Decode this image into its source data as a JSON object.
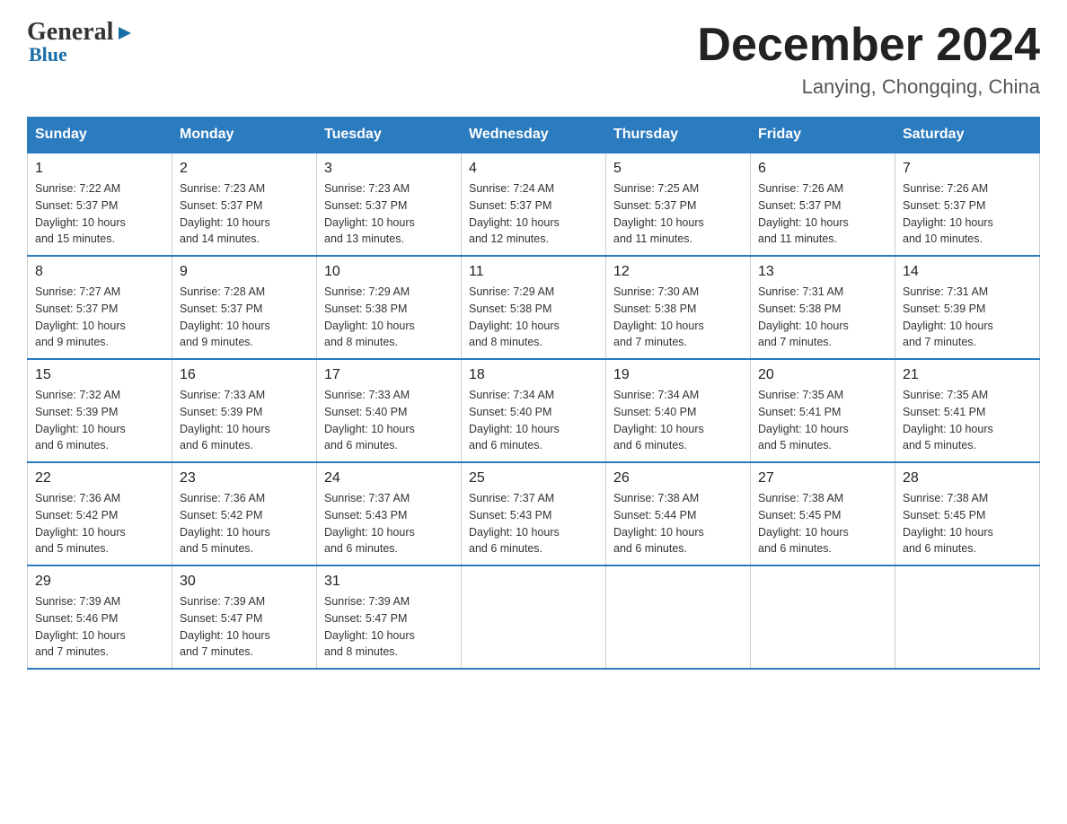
{
  "header": {
    "logo": {
      "general": "General",
      "blue": "Blue",
      "arrow": "▶"
    },
    "title": "December 2024",
    "location": "Lanying, Chongqing, China"
  },
  "days_of_week": [
    "Sunday",
    "Monday",
    "Tuesday",
    "Wednesday",
    "Thursday",
    "Friday",
    "Saturday"
  ],
  "weeks": [
    [
      {
        "day": "1",
        "sunrise": "7:22 AM",
        "sunset": "5:37 PM",
        "daylight": "10 hours and 15 minutes."
      },
      {
        "day": "2",
        "sunrise": "7:23 AM",
        "sunset": "5:37 PM",
        "daylight": "10 hours and 14 minutes."
      },
      {
        "day": "3",
        "sunrise": "7:23 AM",
        "sunset": "5:37 PM",
        "daylight": "10 hours and 13 minutes."
      },
      {
        "day": "4",
        "sunrise": "7:24 AM",
        "sunset": "5:37 PM",
        "daylight": "10 hours and 12 minutes."
      },
      {
        "day": "5",
        "sunrise": "7:25 AM",
        "sunset": "5:37 PM",
        "daylight": "10 hours and 11 minutes."
      },
      {
        "day": "6",
        "sunrise": "7:26 AM",
        "sunset": "5:37 PM",
        "daylight": "10 hours and 11 minutes."
      },
      {
        "day": "7",
        "sunrise": "7:26 AM",
        "sunset": "5:37 PM",
        "daylight": "10 hours and 10 minutes."
      }
    ],
    [
      {
        "day": "8",
        "sunrise": "7:27 AM",
        "sunset": "5:37 PM",
        "daylight": "10 hours and 9 minutes."
      },
      {
        "day": "9",
        "sunrise": "7:28 AM",
        "sunset": "5:37 PM",
        "daylight": "10 hours and 9 minutes."
      },
      {
        "day": "10",
        "sunrise": "7:29 AM",
        "sunset": "5:38 PM",
        "daylight": "10 hours and 8 minutes."
      },
      {
        "day": "11",
        "sunrise": "7:29 AM",
        "sunset": "5:38 PM",
        "daylight": "10 hours and 8 minutes."
      },
      {
        "day": "12",
        "sunrise": "7:30 AM",
        "sunset": "5:38 PM",
        "daylight": "10 hours and 7 minutes."
      },
      {
        "day": "13",
        "sunrise": "7:31 AM",
        "sunset": "5:38 PM",
        "daylight": "10 hours and 7 minutes."
      },
      {
        "day": "14",
        "sunrise": "7:31 AM",
        "sunset": "5:39 PM",
        "daylight": "10 hours and 7 minutes."
      }
    ],
    [
      {
        "day": "15",
        "sunrise": "7:32 AM",
        "sunset": "5:39 PM",
        "daylight": "10 hours and 6 minutes."
      },
      {
        "day": "16",
        "sunrise": "7:33 AM",
        "sunset": "5:39 PM",
        "daylight": "10 hours and 6 minutes."
      },
      {
        "day": "17",
        "sunrise": "7:33 AM",
        "sunset": "5:40 PM",
        "daylight": "10 hours and 6 minutes."
      },
      {
        "day": "18",
        "sunrise": "7:34 AM",
        "sunset": "5:40 PM",
        "daylight": "10 hours and 6 minutes."
      },
      {
        "day": "19",
        "sunrise": "7:34 AM",
        "sunset": "5:40 PM",
        "daylight": "10 hours and 6 minutes."
      },
      {
        "day": "20",
        "sunrise": "7:35 AM",
        "sunset": "5:41 PM",
        "daylight": "10 hours and 5 minutes."
      },
      {
        "day": "21",
        "sunrise": "7:35 AM",
        "sunset": "5:41 PM",
        "daylight": "10 hours and 5 minutes."
      }
    ],
    [
      {
        "day": "22",
        "sunrise": "7:36 AM",
        "sunset": "5:42 PM",
        "daylight": "10 hours and 5 minutes."
      },
      {
        "day": "23",
        "sunrise": "7:36 AM",
        "sunset": "5:42 PM",
        "daylight": "10 hours and 5 minutes."
      },
      {
        "day": "24",
        "sunrise": "7:37 AM",
        "sunset": "5:43 PM",
        "daylight": "10 hours and 6 minutes."
      },
      {
        "day": "25",
        "sunrise": "7:37 AM",
        "sunset": "5:43 PM",
        "daylight": "10 hours and 6 minutes."
      },
      {
        "day": "26",
        "sunrise": "7:38 AM",
        "sunset": "5:44 PM",
        "daylight": "10 hours and 6 minutes."
      },
      {
        "day": "27",
        "sunrise": "7:38 AM",
        "sunset": "5:45 PM",
        "daylight": "10 hours and 6 minutes."
      },
      {
        "day": "28",
        "sunrise": "7:38 AM",
        "sunset": "5:45 PM",
        "daylight": "10 hours and 6 minutes."
      }
    ],
    [
      {
        "day": "29",
        "sunrise": "7:39 AM",
        "sunset": "5:46 PM",
        "daylight": "10 hours and 7 minutes."
      },
      {
        "day": "30",
        "sunrise": "7:39 AM",
        "sunset": "5:47 PM",
        "daylight": "10 hours and 7 minutes."
      },
      {
        "day": "31",
        "sunrise": "7:39 AM",
        "sunset": "5:47 PM",
        "daylight": "10 hours and 8 minutes."
      },
      null,
      null,
      null,
      null
    ]
  ],
  "labels": {
    "sunrise": "Sunrise:",
    "sunset": "Sunset:",
    "daylight": "Daylight:"
  }
}
